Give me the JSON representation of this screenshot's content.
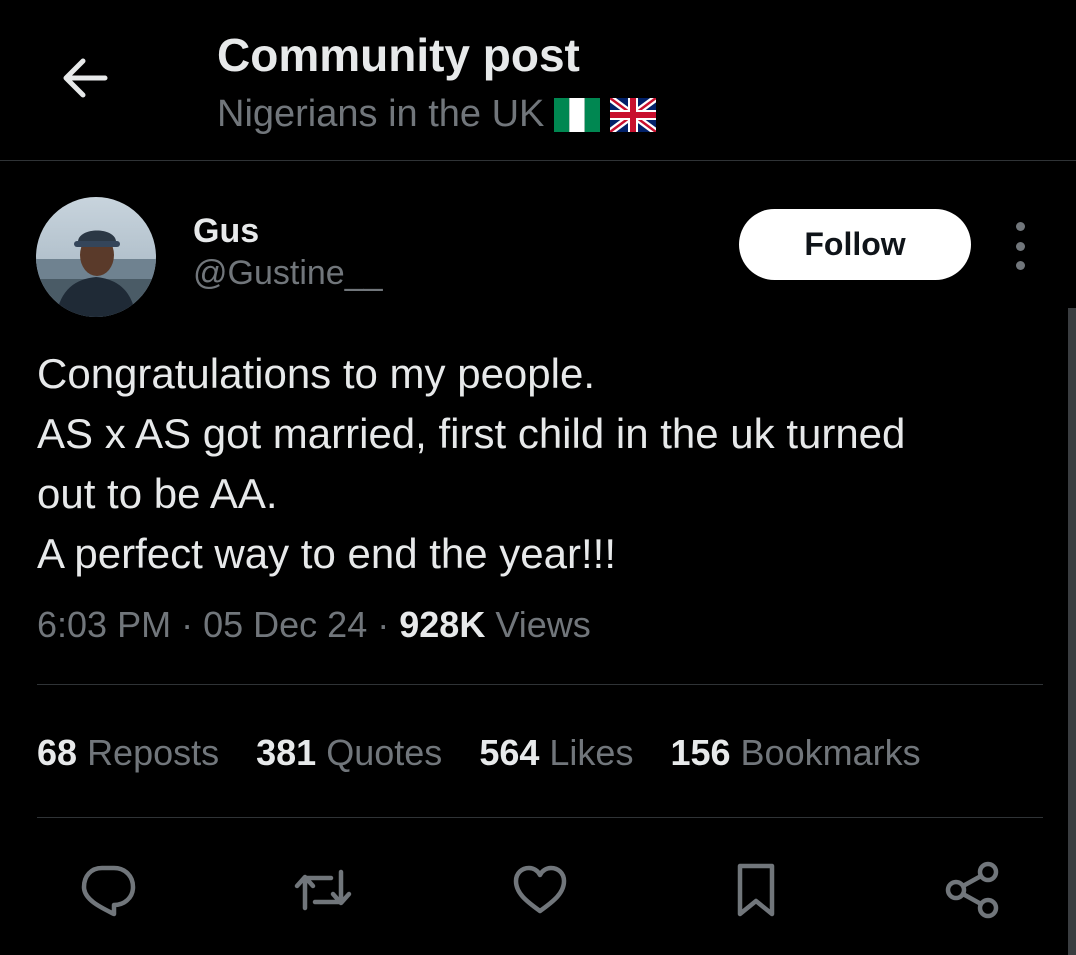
{
  "header": {
    "title": "Community post",
    "community": "Nigerians in the UK",
    "back_icon": "arrow-left-icon",
    "flags": [
      "nigeria-flag",
      "uk-flag"
    ]
  },
  "post": {
    "author_name": "Gus",
    "author_handle": "@Gustine__",
    "follow_label": "Follow",
    "lines": [
      "Congratulations to my people.",
      "AS x AS got married, first child in the uk turned",
      "out to be AA.",
      "A perfect way to end the year!!!"
    ],
    "time": "6:03 PM",
    "date": "05 Dec 24",
    "views_count": "928K",
    "views_label": "Views",
    "separator": "·"
  },
  "stats": {
    "reposts_count": "68",
    "reposts_label": "Reposts",
    "quotes_count": "381",
    "quotes_label": "Quotes",
    "likes_count": "564",
    "likes_label": "Likes",
    "bookmarks_count": "156",
    "bookmarks_label": "Bookmarks"
  },
  "actions": [
    "reply-icon",
    "repost-icon",
    "like-icon",
    "bookmark-icon",
    "share-icon"
  ],
  "colors": {
    "background": "#000000",
    "text": "#e7e9ea",
    "muted": "#71767b",
    "divider": "#2f3336",
    "button": "#ffffff"
  }
}
